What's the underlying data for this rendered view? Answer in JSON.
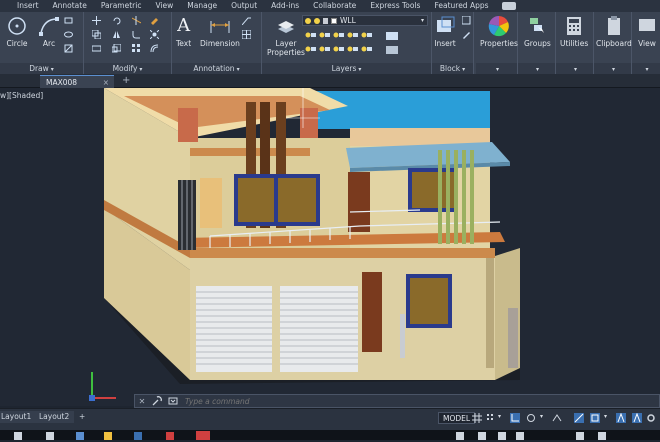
{
  "menu": {
    "items": [
      "View",
      "Insert",
      "Annotate",
      "Parametric",
      "View",
      "Manage",
      "Output",
      "Add-ins",
      "Collaborate",
      "Express Tools",
      "Featured Apps"
    ]
  },
  "ribbon": {
    "draw": {
      "title": "Draw",
      "circle_label": "Circle",
      "arc_label": "Arc"
    },
    "modify": {
      "title": "Modify"
    },
    "annotation": {
      "title": "Annotation",
      "text_label": "Text",
      "dimension_label": "Dimension"
    },
    "layers": {
      "title": "Layers",
      "layer_properties_label": "Layer Properties",
      "current_layer": "WLL"
    },
    "block": {
      "title": "Block",
      "insert_label": "Insert"
    },
    "properties_label": "Properties",
    "groups_label": "Groups",
    "utilities_label": "Utilities",
    "clipboard_label": "Clipboard",
    "view_label": "View"
  },
  "file_tab": {
    "name": "MAX008",
    "close": "×",
    "new": "+"
  },
  "viewport": {
    "label": "w][Shaded]"
  },
  "command": {
    "placeholder": "Type a command",
    "close": "✕"
  },
  "layouts": {
    "tab1": "Layout1",
    "tab2": "Layout2",
    "add": "+"
  },
  "status": {
    "model_label": "MODEL"
  },
  "colors": {
    "accent": "#5b8fd0",
    "ribbon_bg": "#3a4352",
    "viewport_bg": "#212834"
  }
}
